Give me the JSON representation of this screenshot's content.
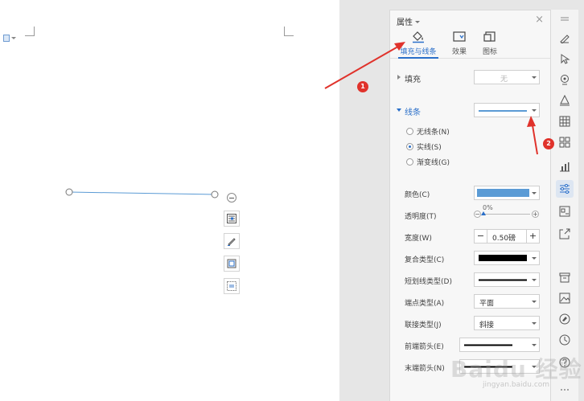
{
  "panel": {
    "title": "属性",
    "close": "×",
    "tabs": [
      {
        "label": "填充与线条",
        "active": true
      },
      {
        "label": "效果",
        "active": false
      },
      {
        "label": "图标",
        "active": false
      }
    ],
    "fill": {
      "label": "填充",
      "value": "无"
    },
    "line": {
      "label": "线条",
      "radios": [
        {
          "label": "无线条(N)",
          "checked": false
        },
        {
          "label": "实线(S)",
          "checked": true
        },
        {
          "label": "渐变线(G)",
          "checked": false
        }
      ]
    },
    "props": {
      "color": {
        "label": "颜色(C)",
        "value": "#5b9bd5"
      },
      "transparency": {
        "label": "透明度(T)",
        "value": "0%",
        "level": 0
      },
      "width": {
        "label": "宽度(W)",
        "value": "0.50磅",
        "minus": "−",
        "plus": "+"
      },
      "compound": {
        "label": "复合类型(C)"
      },
      "dash": {
        "label": "短划线类型(D)"
      },
      "cap": {
        "label": "端点类型(A)",
        "value": "平面"
      },
      "join": {
        "label": "联接类型(J)",
        "value": "斜接"
      },
      "begin_arrow": {
        "label": "前端箭头(E)"
      },
      "end_arrow": {
        "label": "末端箭头(N)"
      }
    }
  },
  "annotations": {
    "badge1": "1",
    "badge2": "2"
  },
  "watermark": {
    "main": "Baidu 经验",
    "sub": "jingyan.baidu.com"
  },
  "colors": {
    "accent": "#2a6fc9",
    "line_color": "#5b9bd5",
    "annotation": "#e0322b"
  }
}
